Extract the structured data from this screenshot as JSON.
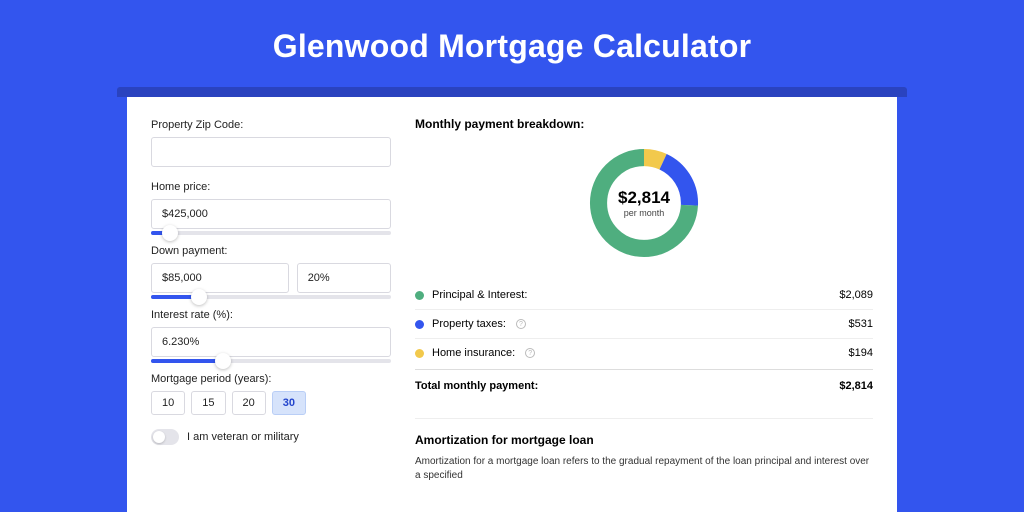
{
  "title": "Glenwood Mortgage Calculator",
  "form": {
    "zip_label": "Property Zip Code:",
    "zip_value": "",
    "home_price_label": "Home price:",
    "home_price_value": "$425,000",
    "home_price_slider_pct": 8,
    "down_payment_label": "Down payment:",
    "down_payment_value": "$85,000",
    "down_payment_pct_value": "20%",
    "down_payment_slider_pct": 20,
    "interest_label": "Interest rate (%):",
    "interest_value": "6.230%",
    "interest_slider_pct": 30,
    "period_label": "Mortgage period (years):",
    "periods": [
      "10",
      "15",
      "20",
      "30"
    ],
    "period_active_index": 3,
    "veteran_label": "I am veteran or military",
    "veteran_on": false
  },
  "breakdown": {
    "title": "Monthly payment breakdown:",
    "center_amount": "$2,814",
    "center_sub": "per month",
    "items": [
      {
        "label": "Principal & Interest:",
        "value": "$2,089",
        "color": "g",
        "info": false,
        "num": 2089
      },
      {
        "label": "Property taxes:",
        "value": "$531",
        "color": "b",
        "info": true,
        "num": 531
      },
      {
        "label": "Home insurance:",
        "value": "$194",
        "color": "y",
        "info": true,
        "num": 194
      }
    ],
    "total_label": "Total monthly payment:",
    "total_value": "$2,814"
  },
  "chart_data": {
    "type": "pie",
    "title": "Monthly payment breakdown",
    "series": [
      {
        "name": "Principal & Interest",
        "value": 2089,
        "color": "#4fae7f"
      },
      {
        "name": "Property taxes",
        "value": 531,
        "color": "#3355ee"
      },
      {
        "name": "Home insurance",
        "value": 194,
        "color": "#f2c94c"
      }
    ],
    "total": 2814,
    "center_label": "$2,814 per month"
  },
  "amort": {
    "title": "Amortization for mortgage loan",
    "text": "Amortization for a mortgage loan refers to the gradual repayment of the loan principal and interest over a specified"
  }
}
